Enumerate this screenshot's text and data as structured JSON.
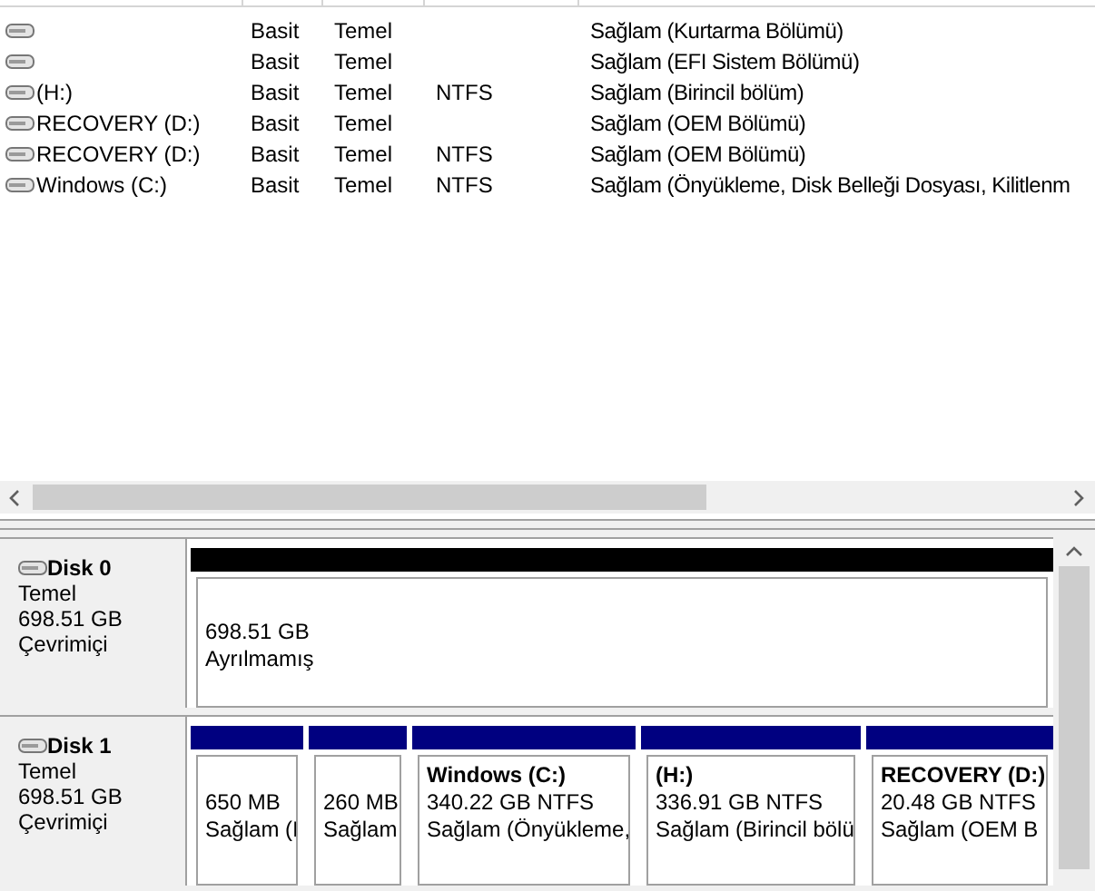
{
  "volumes": [
    {
      "layout": "Basit",
      "type": "Temel",
      "status": "Sağlam (Kurtarma Bölümü)"
    },
    {
      "layout": "Basit",
      "type": "Temel",
      "status": "Sağlam (EFI Sistem Bölümü)"
    },
    {
      "name": " (H:)",
      "layout": "Basit",
      "type": "Temel",
      "file_system": "NTFS",
      "status": "Sağlam (Birincil bölüm)"
    },
    {
      "name": "RECOVERY (D:)",
      "layout": "Basit",
      "type": "Temel",
      "status": "Sağlam (OEM Bölümü)"
    },
    {
      "name": "RECOVERY (D:)",
      "layout": "Basit",
      "type": "Temel",
      "file_system": "NTFS",
      "status": "Sağlam (OEM Bölümü)"
    },
    {
      "name": "Windows (C:)",
      "layout": "Basit",
      "type": "Temel",
      "file_system": "NTFS",
      "status": "Sağlam (Önyükleme, Disk Belleği Dosyası, Kilitlenm"
    }
  ],
  "disks": [
    {
      "name": "Disk 0",
      "type": "Temel",
      "size": "698.51 GB",
      "state": "Çevrimiçi",
      "partitions": [
        {
          "kind": "unallocated",
          "size": "698.51 GB",
          "status": "Ayrılmamış"
        }
      ]
    },
    {
      "name": "Disk 1",
      "type": "Temel",
      "size": "698.51 GB",
      "state": "Çevrimiçi",
      "partitions": [
        {
          "kind": "primary",
          "size": "650 MB",
          "status": "Sağlam (I"
        },
        {
          "kind": "primary",
          "size": "260 MB",
          "status": "Sağlam"
        },
        {
          "kind": "primary",
          "title": "Windows  (C:)",
          "size": "340.22 GB NTFS",
          "status": "Sağlam (Önyükleme,"
        },
        {
          "kind": "primary",
          "title": " (H:)",
          "size": "336.91 GB NTFS",
          "status": "Sağlam (Birincil bölü"
        },
        {
          "kind": "primary",
          "title": "RECOVERY  (D:)",
          "size": "20.48 GB NTFS",
          "status": "Sağlam (OEM B"
        }
      ]
    }
  ]
}
